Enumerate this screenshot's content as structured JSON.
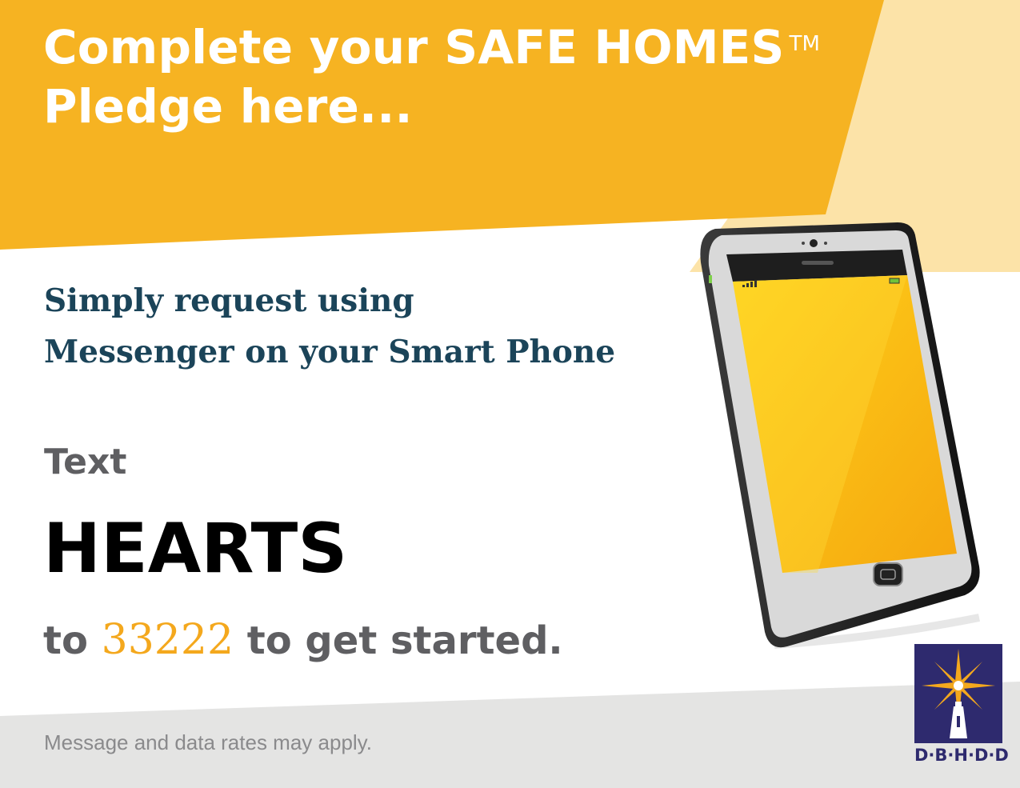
{
  "headline": {
    "line1": "Complete your SAFE HOMES",
    "trademark": "TM",
    "line2": "Pledge here..."
  },
  "subhead": {
    "line1": "Simply request using",
    "line2": "Messenger on your Smart Phone"
  },
  "instruction": {
    "text_word": "Text",
    "keyword": "HEARTS",
    "to_word": "to",
    "short_code": "33222",
    "suffix": "to get started."
  },
  "disclaimer": "Message and data rates may apply.",
  "logo": {
    "name": "D·B·H·D·D",
    "icon": "star-lighthouse-icon"
  },
  "phone": {
    "icon": "smartphone-icon"
  },
  "colors": {
    "brand_orange": "#f5b21e",
    "light_orange": "#fbe3a6",
    "navy": "#1b4459",
    "gray_text": "#5f5f62",
    "logo_blue": "#2e2a6e"
  }
}
